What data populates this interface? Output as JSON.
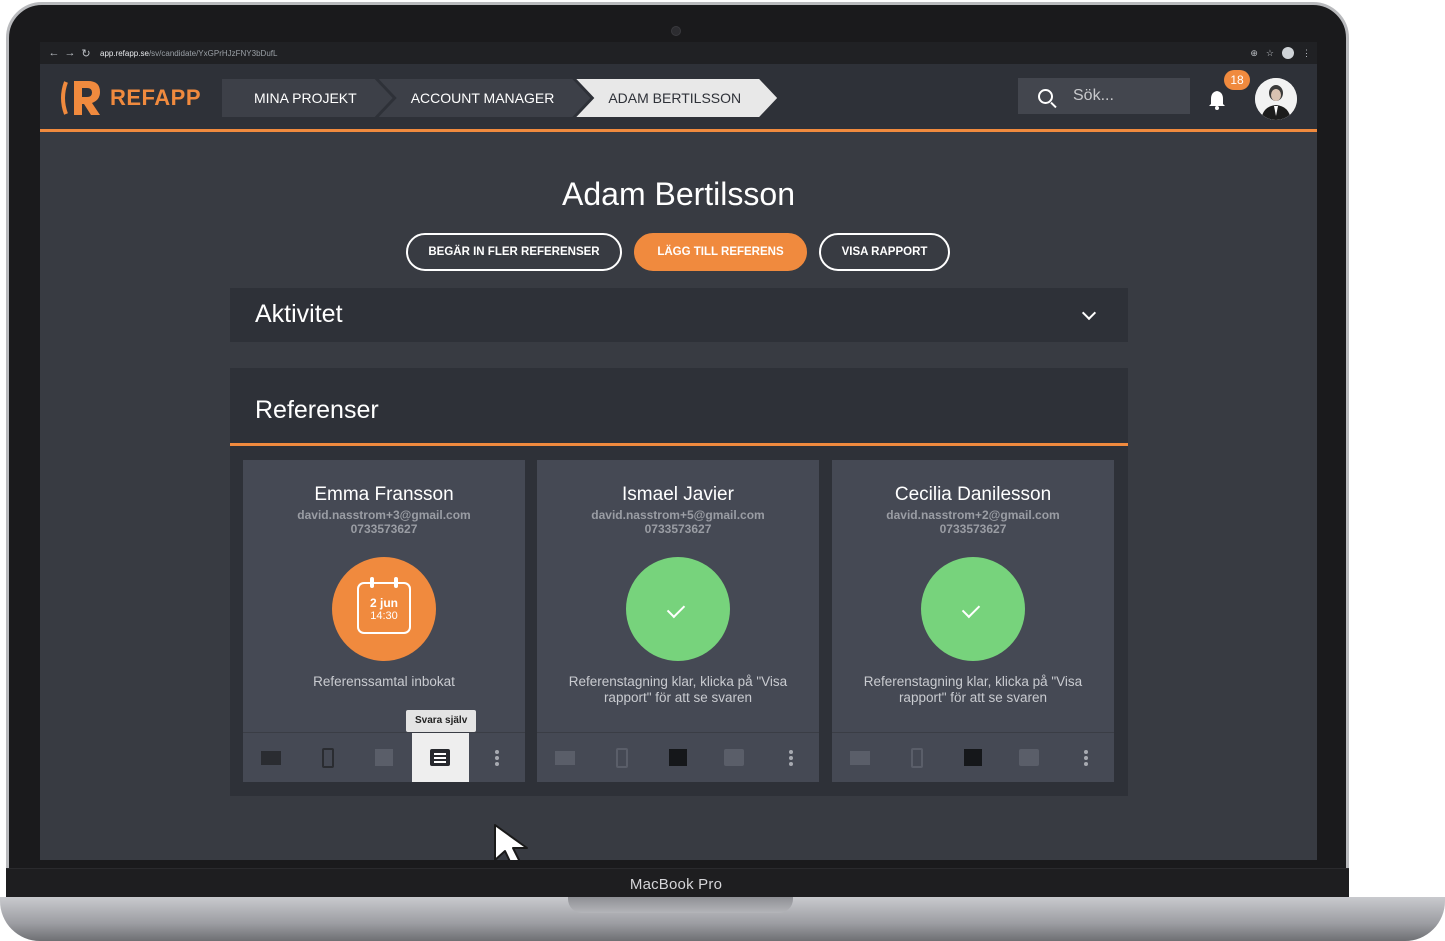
{
  "device": {
    "label": "MacBook Pro"
  },
  "browser": {
    "url_host": "app.refapp.se",
    "url_path": "/sv/candidate/YxGPrHJzFNY3bDufL"
  },
  "header": {
    "logo_text": "REFAPP",
    "breadcrumbs": [
      {
        "label": "MINA PROJEKT"
      },
      {
        "label": "ACCOUNT MANAGER"
      },
      {
        "label": "ADAM BERTILSSON"
      }
    ],
    "search_placeholder": "Sök...",
    "notification_count": "18",
    "accent_color": "#f08a3e"
  },
  "candidate": {
    "name": "Adam Bertilsson",
    "actions": {
      "request_more": "BEGÄR IN FLER REFERENSER",
      "add_reference": "LÄGG TILL REFERENS",
      "show_report": "VISA RAPPORT"
    }
  },
  "activity": {
    "title": "Aktivitet"
  },
  "references": {
    "title": "Referenser",
    "cards": [
      {
        "name": "Emma Fransson",
        "email": "david.nasstrom+3@gmail.com",
        "phone": "0733573627",
        "status_type": "booked",
        "date": "2 jun",
        "time": "14:30",
        "status_text": "Referenssamtal inbokat"
      },
      {
        "name": "Ismael Javier",
        "email": "david.nasstrom+5@gmail.com",
        "phone": "0733573627",
        "status_type": "done",
        "status_text": "Referenstagning klar, klicka på \"Visa rapport\" för att se svaren"
      },
      {
        "name": "Cecilia Danilesson",
        "email": "david.nasstrom+2@gmail.com",
        "phone": "0733573627",
        "status_type": "done",
        "status_text": "Referenstagning klar, klicka på \"Visa rapport\" för att se svaren"
      }
    ],
    "tooltip": "Svara själv"
  }
}
